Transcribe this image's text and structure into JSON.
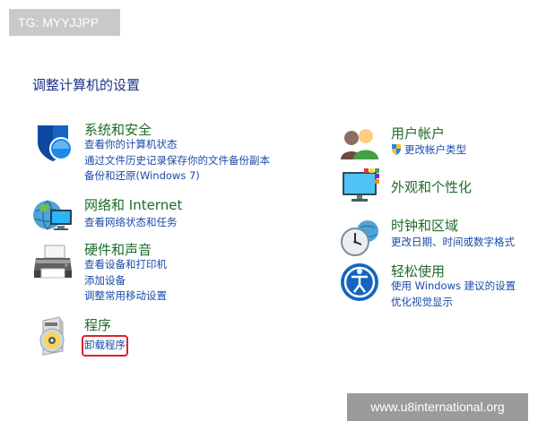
{
  "watermarks": {
    "top_left": "TG: MYYJJPP",
    "bottom_right": "www.u8international.org"
  },
  "page_title": "调整计算机的设置",
  "categories": {
    "system_security": {
      "title": "系统和安全",
      "icon": "shield-icon",
      "links": [
        "查看你的计算机状态",
        "通过文件历史记录保存你的文件备份副本",
        "备份和还原(Windows 7)"
      ]
    },
    "network": {
      "title": "网络和 Internet",
      "icon": "network-globe-icon",
      "links": [
        "查看网络状态和任务"
      ]
    },
    "hardware_sound": {
      "title": "硬件和声音",
      "icon": "printer-icon",
      "links": [
        "查看设备和打印机",
        "添加设备",
        "调整常用移动设置"
      ]
    },
    "programs": {
      "title": "程序",
      "icon": "programs-disc-icon",
      "links": [
        "卸载程序"
      ],
      "highlighted_link": "卸载程序",
      "highlight_color": "#d42727"
    },
    "user_accounts": {
      "title": "用户帐户",
      "icon": "users-icon",
      "links": [
        "更改帐户类型"
      ],
      "link_icon": "uac-shield-icon"
    },
    "appearance": {
      "title": "外观和个性化",
      "icon": "monitor-palette-icon",
      "links": []
    },
    "clock_region": {
      "title": "时钟和区域",
      "icon": "clock-globe-icon",
      "links": [
        "更改日期、时间或数字格式"
      ]
    },
    "ease_of_access": {
      "title": "轻松使用",
      "icon": "accessibility-icon",
      "links": [
        "使用 Windows 建议的设置",
        "优化视觉显示"
      ]
    }
  },
  "colors": {
    "heading_green": "#1e6b2a",
    "link_blue": "#1a4aa8",
    "title_blue": "#1e3287",
    "highlight_red": "#d42727"
  }
}
